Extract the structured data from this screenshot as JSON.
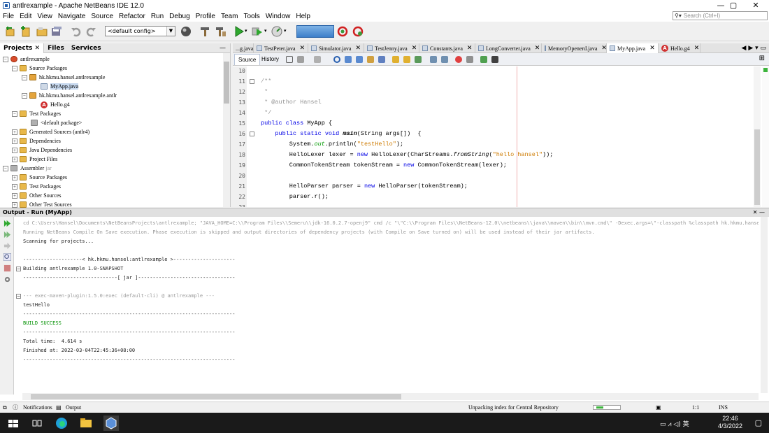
{
  "window": {
    "title": "antlrexample - Apache NetBeans IDE 12.0",
    "controls": [
      "—",
      "▢",
      "✕"
    ]
  },
  "menu": [
    "File",
    "Edit",
    "View",
    "Navigate",
    "Source",
    "Refactor",
    "Run",
    "Debug",
    "Profile",
    "Team",
    "Tools",
    "Window",
    "Help"
  ],
  "search": {
    "placeholder": "Search (Ctrl+I)"
  },
  "toolbar": {
    "config": "<default config>"
  },
  "projects_panel": {
    "tabs": [
      "Projects",
      "Files",
      "Services"
    ],
    "tree": [
      {
        "label": "antlrexample"
      },
      {
        "label": "Source Packages"
      },
      {
        "label": "hk.hkmu.hansel.antlrexample"
      },
      {
        "label": "MyApp.java"
      },
      {
        "label": "hk.hkmu.hansel.antlrexample.antlr"
      },
      {
        "label": "Hello.g4"
      },
      {
        "label": "Test Packages"
      },
      {
        "label": "<default package>"
      },
      {
        "label": "Generated Sources (antlr4)"
      },
      {
        "label": "Dependencies"
      },
      {
        "label": "Java Dependencies"
      },
      {
        "label": "Project Files"
      },
      {
        "label": "Assembler",
        "suffix": "jar"
      },
      {
        "label": "Source Packages"
      },
      {
        "label": "Test Packages"
      },
      {
        "label": "Other Sources"
      },
      {
        "label": "Other Test Sources"
      }
    ]
  },
  "editor": {
    "tabs": [
      {
        "label": "...g.java"
      },
      {
        "label": "TestPeter.java"
      },
      {
        "label": "Simulator.java"
      },
      {
        "label": "TestJenny.java"
      },
      {
        "label": "Constants.java"
      },
      {
        "label": "LongConverter.java"
      },
      {
        "label": "MemoryOpenerd.java"
      },
      {
        "label": "MyApp.java"
      },
      {
        "label": "Hello.g4"
      }
    ],
    "view_tabs": [
      "Source",
      "History"
    ],
    "line_numbers": [
      "10",
      "11",
      "12",
      "13",
      "14",
      "15",
      "16",
      "17",
      "18",
      "19",
      "20",
      "21",
      "22",
      "23"
    ],
    "code": {
      "l11": "/**",
      "l12": " *",
      "l13": " * @author Hansel",
      "l14": " */",
      "l15a": "public class ",
      "l15b": "MyApp {",
      "l16a": "    public static void ",
      "l16b": "main",
      "l16c": "(String args[])  {",
      "l17a": "        System.",
      "l17b": "out",
      "l17c": ".println(",
      "l17d": "\"testHello\"",
      "l17e": ");",
      "l18a": "        HelloLexer lexer = ",
      "l18b": "new",
      "l18c": " HelloLexer(CharStreams.",
      "l18d": "fromString",
      "l18e": "(",
      "l18f": "\"hello hansel\"",
      "l18g": "));",
      "l19a": "        CommonTokenStream tokenStream = ",
      "l19b": "new",
      "l19c": " CommonTokenStream(lexer);",
      "l21a": "        HelloParser parser = ",
      "l21b": "new",
      "l21c": " HelloParser(tokenStream);",
      "l22": "        parser.r();"
    }
  },
  "output": {
    "title": "Output - Run (MyApp)",
    "lines": [
      "cd C:\\Users\\Hansel\\Documents\\NetBeansProjects\\antlrexample; \"JAVA_HOME=C:\\\\Program Files\\\\Semeru\\\\jdk-16.0.2.7-openj9\" cmd /c \"\\\"C:\\\\Program Files\\\\NetBeans-12.0\\\\netbeans\\\\java\\\\maven\\\\bin\\\\mvn.cmd\\\" -Dexec.args=\\\"-classpath %classpath hk.hkmu.hansel.antlrexamp",
      "Running NetBeans Compile On Save execution. Phase execution is skipped and output directories of dependency projects (with Compile on Save turned on) will be used instead of their jar artifacts.",
      "Scanning for projects...",
      "",
      "--------------------< hk.hkmu.hansel:antlrexample >---------------------",
      "Building antlrexample 1.0-SNAPSHOT",
      "--------------------------------[ jar ]---------------------------------",
      "",
      "--- exec-maven-plugin:1.5.0:exec (default-cli) @ antlrexample ---",
      "testHello",
      "------------------------------------------------------------------------",
      "BUILD SUCCESS",
      "------------------------------------------------------------------------",
      "Total time:  4.614 s",
      "Finished at: 2022-03-04T22:45:36+08:00",
      "------------------------------------------------------------------------"
    ]
  },
  "status": {
    "notifications": "Notifications",
    "output": "Output",
    "indexing": "Unpacking index for Central Repository",
    "position": "1:1",
    "mode": "INS"
  },
  "taskbar": {
    "time": "22:46",
    "date": "4/3/2022",
    "ime": "英"
  }
}
